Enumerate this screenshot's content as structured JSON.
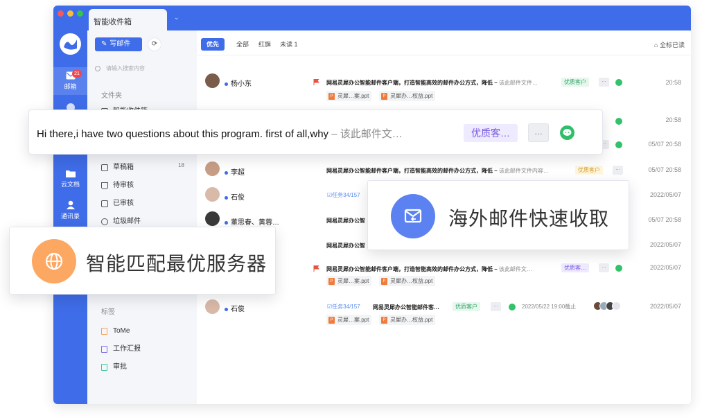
{
  "window": {
    "tab_title": "智能收件箱",
    "tab_chevron": "⌄",
    "traffic_lights": [
      "#f5595a",
      "#f6be3b",
      "#34c84a"
    ]
  },
  "rail": {
    "items": [
      {
        "label": "邮箱",
        "icon": "mail-icon",
        "badge": "21"
      },
      {
        "label": "",
        "icon": "chat-icon"
      },
      {
        "label": "云文档",
        "icon": "cloud-doc-icon"
      },
      {
        "label": "通讯录",
        "icon": "contacts-icon"
      }
    ]
  },
  "folders": {
    "compose_label": "写邮件",
    "refresh_icon": "refresh-icon",
    "search_placeholder": "请输入搜索内容",
    "section_title": "文件夹",
    "items": [
      {
        "label": "智能收件箱",
        "count": "8",
        "icon": "inbox-icon"
      },
      {
        "label": "草稿箱",
        "count": "18",
        "icon": "draft-icon"
      },
      {
        "label": "待审核",
        "count": "",
        "icon": "pending-review-icon"
      },
      {
        "label": "已审核",
        "count": "",
        "icon": "reviewed-icon"
      },
      {
        "label": "垃圾邮件",
        "count": "",
        "icon": "spam-icon"
      }
    ],
    "tags_title": "标签",
    "tags": [
      {
        "label": "ToMe",
        "color": "#f5a15a"
      },
      {
        "label": "工作汇报",
        "color": "#7b6cf0"
      },
      {
        "label": "审批",
        "color": "#3fc5a4"
      }
    ]
  },
  "toolbar": {
    "filters": [
      "优先",
      "全部",
      "红旗",
      "未读 1"
    ],
    "mark_all_read": "全标已读"
  },
  "messages": [
    {
      "sender": "杨小东",
      "subject": "网易灵犀办公智能邮件客户端，打造智能高效的邮件办公方式，降低 –",
      "summary": "该此邮件文件…",
      "tag": "优质客户",
      "time": "20:58",
      "attachments": [
        "灵犀…案.ppt",
        "灵犀办…权益.ppt"
      ]
    },
    {
      "sender": "",
      "subject": "",
      "summary": "",
      "tag": "",
      "time": "20:58",
      "attachments": []
    },
    {
      "sender": "",
      "subject": "",
      "summary": "",
      "tag": "",
      "time": "05/07 20:58",
      "attachments": []
    },
    {
      "sender": "李超",
      "subject": "网易灵犀办公智能邮件客户端，打造智能高效的邮件办公方式，降低 –",
      "summary": "该此邮件文件内容…",
      "tag": "优质客户",
      "time": "05/07 20:58",
      "attachments": []
    },
    {
      "sender": "石俊",
      "task": "任务34/157",
      "subject": "",
      "summary": "",
      "tag": "",
      "time": "2022/05/07",
      "attachments": []
    },
    {
      "sender": "董思春、黄蓉…",
      "subject": "网易灵犀办公智",
      "summary": "",
      "tag": "",
      "time": "05/07 20:58",
      "attachments": []
    },
    {
      "sender": "",
      "subject": "网易灵犀办公智",
      "summary": "",
      "tag": "",
      "time": "2022/05/07",
      "attachments": []
    },
    {
      "sender": "",
      "subject": "网易灵犀办公智能邮件客户端，打造智能高效的邮件办公方式，降低 –",
      "summary": "该此邮件文…",
      "tag": "优质客…",
      "time": "2022/05/07",
      "attachments": [
        "灵犀…案.ppt",
        "灵犀办…权益.ppt"
      ]
    },
    {
      "sender": "石俊",
      "task": "任务34/157",
      "subject": "网易灵犀办公智能邮件客…",
      "summary": "",
      "tag": "优质客户",
      "deadline": "2022/05/22 19:00截止",
      "time": "2022/05/07",
      "attachments": [
        "灵犀…案.ppt",
        "灵犀办…权益.ppt"
      ]
    }
  ],
  "overlays": {
    "english_preview": {
      "text": "Hi there,i have two questions about this program. first of all,why",
      "summary": "– 该此邮件文…",
      "tag": "优质客…",
      "more": "…"
    },
    "overseas": {
      "label": "海外邮件快速收取",
      "icon": "mail-receive-icon"
    },
    "server": {
      "label": "智能匹配最优服务器",
      "icon": "globe-icon"
    }
  }
}
